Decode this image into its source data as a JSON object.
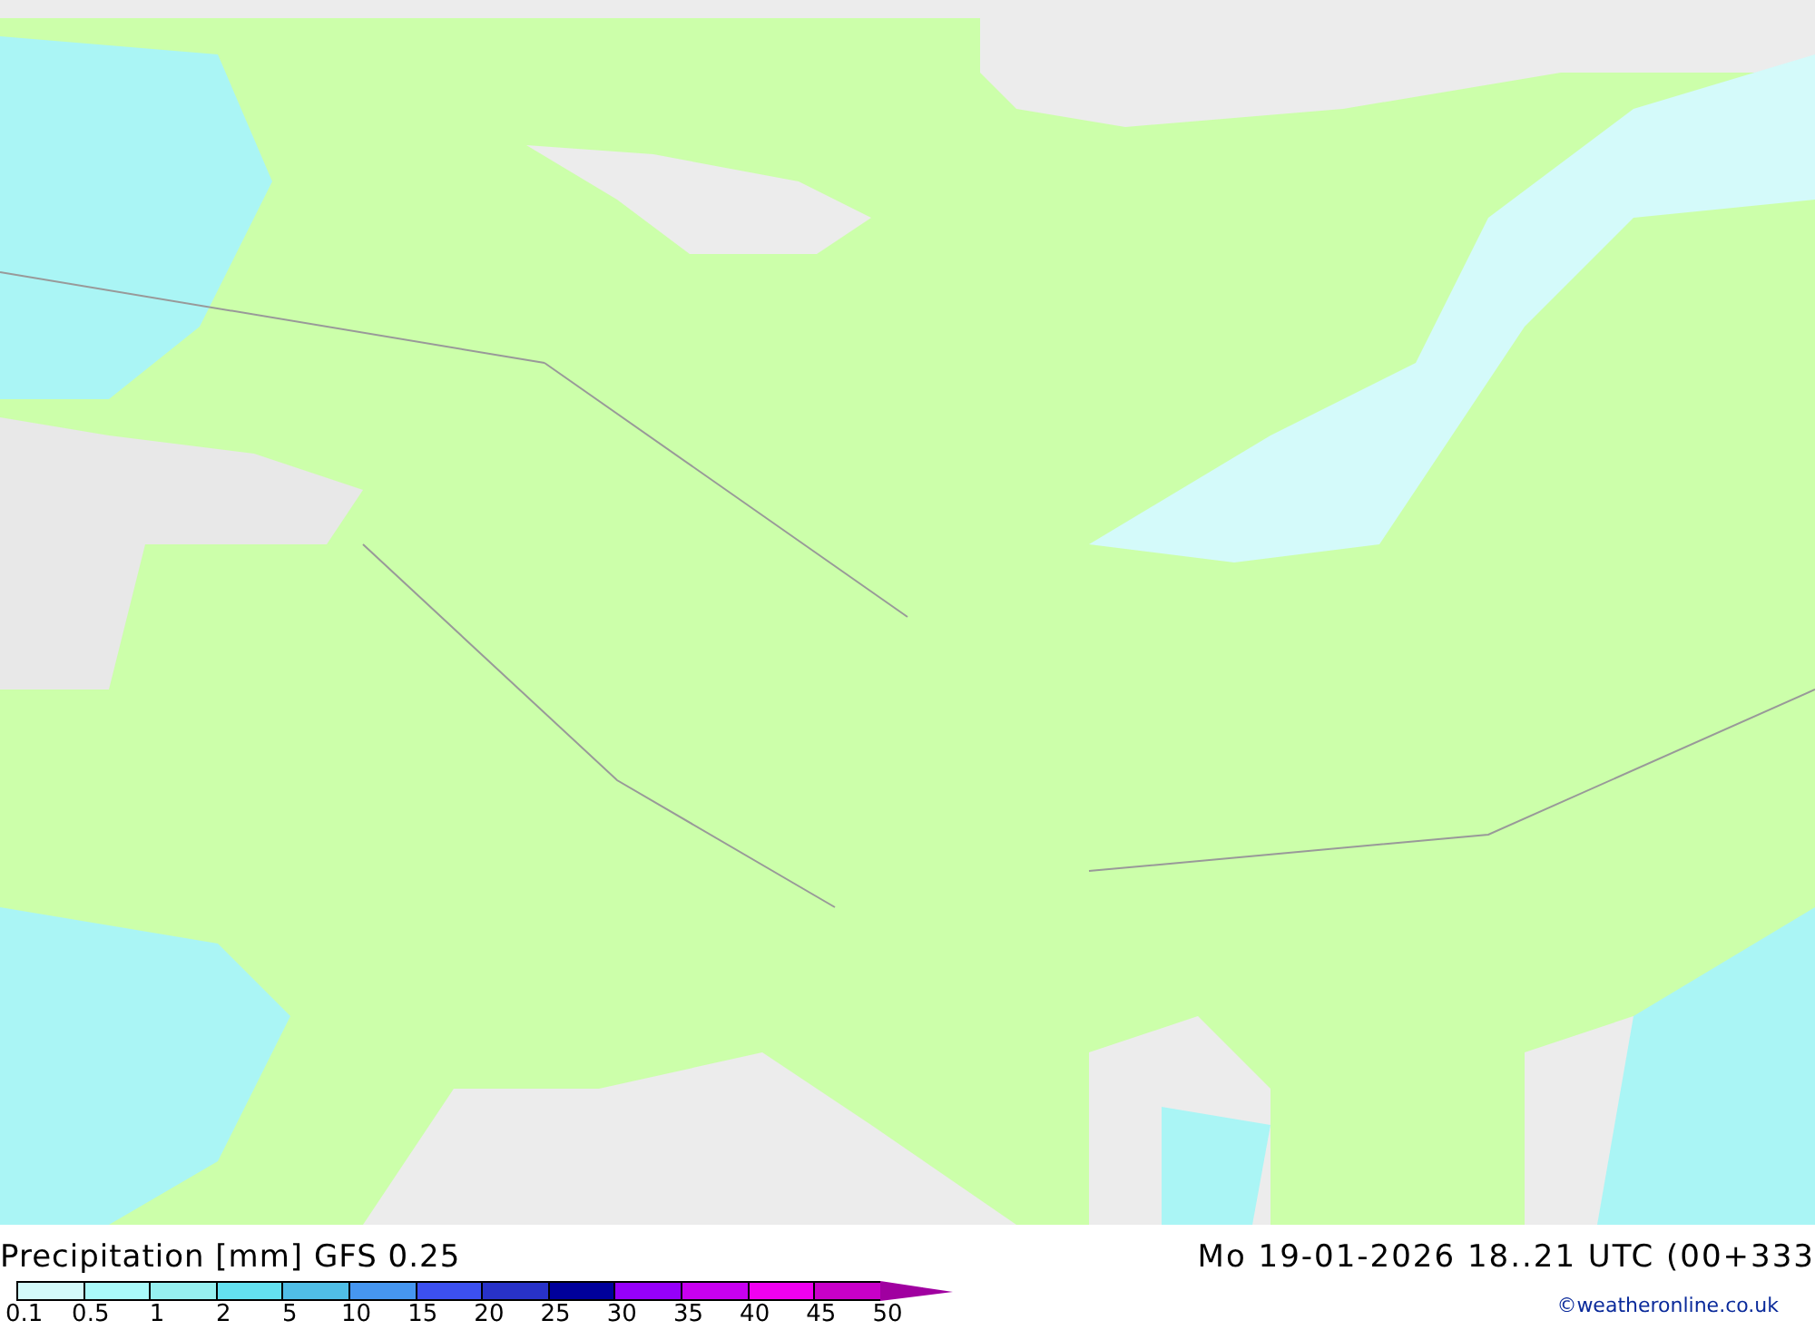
{
  "title": "Precipitation [mm] GFS 0.25",
  "valid_time": "Mo 19-01-2026 18..21 UTC (00+333",
  "legend": {
    "bins": [
      {
        "color": "#d4fafa"
      },
      {
        "color": "#aafafa"
      },
      {
        "color": "#96f0f0"
      },
      {
        "color": "#64e1f0"
      },
      {
        "color": "#50bee6"
      },
      {
        "color": "#4696f0"
      },
      {
        "color": "#3c50f0"
      },
      {
        "color": "#2832c8"
      },
      {
        "color": "#00009b"
      },
      {
        "color": "#9600fa"
      },
      {
        "color": "#c800f0"
      },
      {
        "color": "#f000f0"
      },
      {
        "color": "#c800c8"
      },
      {
        "kind": "arrow",
        "color": "#a000a0"
      }
    ],
    "labels": [
      "0.1",
      "0.5",
      "1",
      "2",
      "5",
      "10",
      "15",
      "20",
      "25",
      "30",
      "35",
      "40",
      "45",
      "50"
    ]
  },
  "credit": "©weatheronline.co.uk"
}
